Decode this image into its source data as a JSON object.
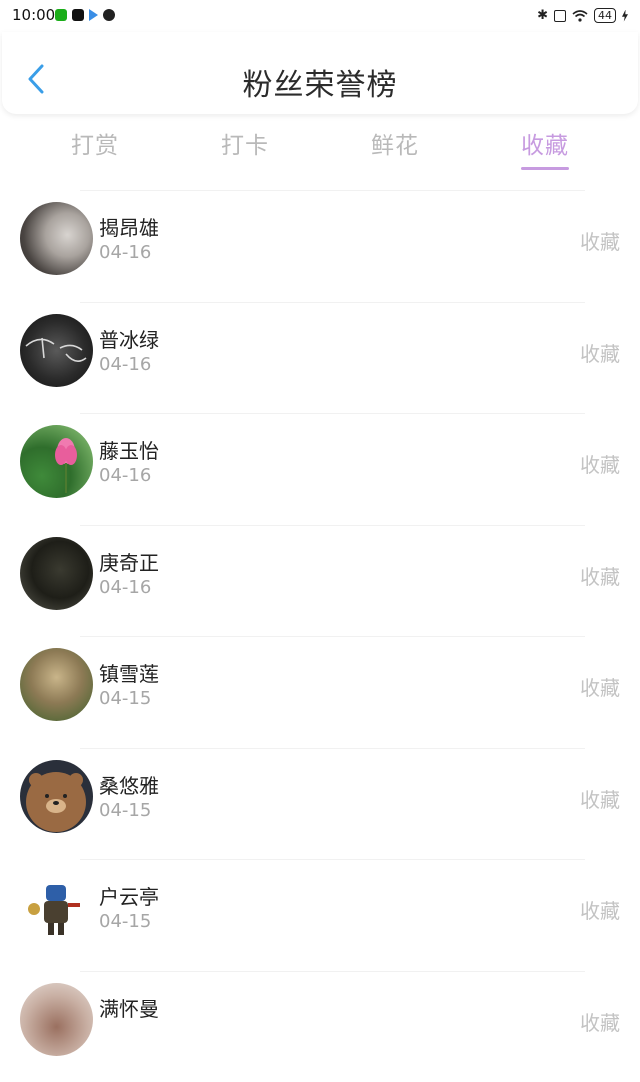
{
  "status_bar": {
    "time": "10:00",
    "battery": "44"
  },
  "header": {
    "title": "粉丝荣誉榜"
  },
  "tabs": [
    {
      "label": "打赏",
      "active": false
    },
    {
      "label": "打卡",
      "active": false
    },
    {
      "label": "鲜花",
      "active": false
    },
    {
      "label": "收藏",
      "active": true
    }
  ],
  "colors": {
    "accent": "#c79be0",
    "muted": "#b9b9b9"
  },
  "list": [
    {
      "name": "揭昂雄",
      "date": "04-16",
      "action": "收藏"
    },
    {
      "name": "普冰绿",
      "date": "04-16",
      "action": "收藏"
    },
    {
      "name": "藤玉怡",
      "date": "04-16",
      "action": "收藏"
    },
    {
      "name": "庚奇正",
      "date": "04-16",
      "action": "收藏"
    },
    {
      "name": "镇雪莲",
      "date": "04-15",
      "action": "收藏"
    },
    {
      "name": "桑悠雅",
      "date": "04-15",
      "action": "收藏"
    },
    {
      "name": "户云亭",
      "date": "04-15",
      "action": "收藏"
    },
    {
      "name": "满怀曼",
      "date": "",
      "action": "收藏"
    }
  ]
}
